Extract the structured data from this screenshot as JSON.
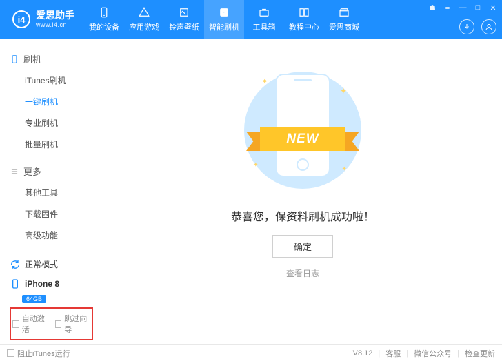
{
  "brand": {
    "name": "爱思助手",
    "url": "www.i4.cn",
    "logo_text": "i4"
  },
  "nav": [
    {
      "id": "device",
      "label": "我的设备"
    },
    {
      "id": "apps",
      "label": "应用游戏"
    },
    {
      "id": "ringtone",
      "label": "铃声壁纸"
    },
    {
      "id": "flash",
      "label": "智能刷机",
      "active": true
    },
    {
      "id": "toolbox",
      "label": "工具箱"
    },
    {
      "id": "tutorial",
      "label": "教程中心"
    },
    {
      "id": "store",
      "label": "爱思商城"
    }
  ],
  "sidebar": {
    "section_flash": {
      "title": "刷机",
      "items": [
        {
          "id": "itunes-flash",
          "label": "iTunes刷机"
        },
        {
          "id": "oneclick-flash",
          "label": "一键刷机",
          "active": true
        },
        {
          "id": "pro-flash",
          "label": "专业刷机"
        },
        {
          "id": "batch-flash",
          "label": "批量刷机"
        }
      ]
    },
    "section_more": {
      "title": "更多",
      "items": [
        {
          "id": "other-tools",
          "label": "其他工具"
        },
        {
          "id": "download-fw",
          "label": "下载固件"
        },
        {
          "id": "advanced",
          "label": "高级功能"
        }
      ]
    },
    "mode": "正常模式",
    "device": "iPhone 8",
    "storage": "64GB",
    "auto_activate": "自动激活",
    "skip_wizard": "跳过向导"
  },
  "main": {
    "ribbon_text": "NEW",
    "success": "恭喜您，保资料刷机成功啦！",
    "confirm": "确定",
    "view_log": "查看日志"
  },
  "footer": {
    "block_itunes": "阻止iTunes运行",
    "version": "V8.12",
    "support": "客服",
    "wechat": "微信公众号",
    "update": "检查更新"
  }
}
